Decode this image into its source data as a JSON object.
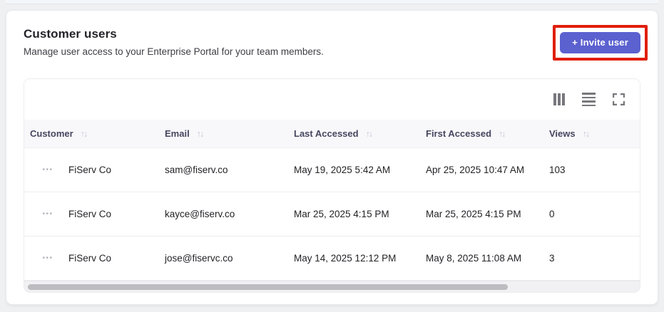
{
  "page": {
    "title": "Customer users",
    "subtitle": "Manage user access to your Enterprise Portal for your team members.",
    "invite_button_label": "+ Invite user"
  },
  "colors": {
    "accent_button": "#5b61cf",
    "highlight_annotation": "#e11e0a",
    "table_header_bg": "#f8f8fb"
  },
  "icons": {
    "sort": "↑↓",
    "row_menu": "•••",
    "toolbar": [
      "columns-icon",
      "density-icon",
      "fullscreen-icon"
    ]
  },
  "table": {
    "columns": [
      "Customer",
      "Email",
      "Last Accessed",
      "First Accessed",
      "Views"
    ],
    "rows": [
      {
        "customer": "FiServ Co",
        "email": "sam@fiserv.co",
        "last_accessed": "May 19, 2025 5:42 AM",
        "first_accessed": "Apr 25, 2025 10:47 AM",
        "views": "103"
      },
      {
        "customer": "FiServ Co",
        "email": "kayce@fiserv.co",
        "last_accessed": "Mar 25, 2025 4:15 PM",
        "first_accessed": "Mar 25, 2025 4:15 PM",
        "views": "0"
      },
      {
        "customer": "FiServ Co",
        "email": "jose@fiservc.co",
        "last_accessed": "May 14, 2025 12:12 PM",
        "first_accessed": "May 8, 2025 11:08 AM",
        "views": "3"
      }
    ]
  }
}
